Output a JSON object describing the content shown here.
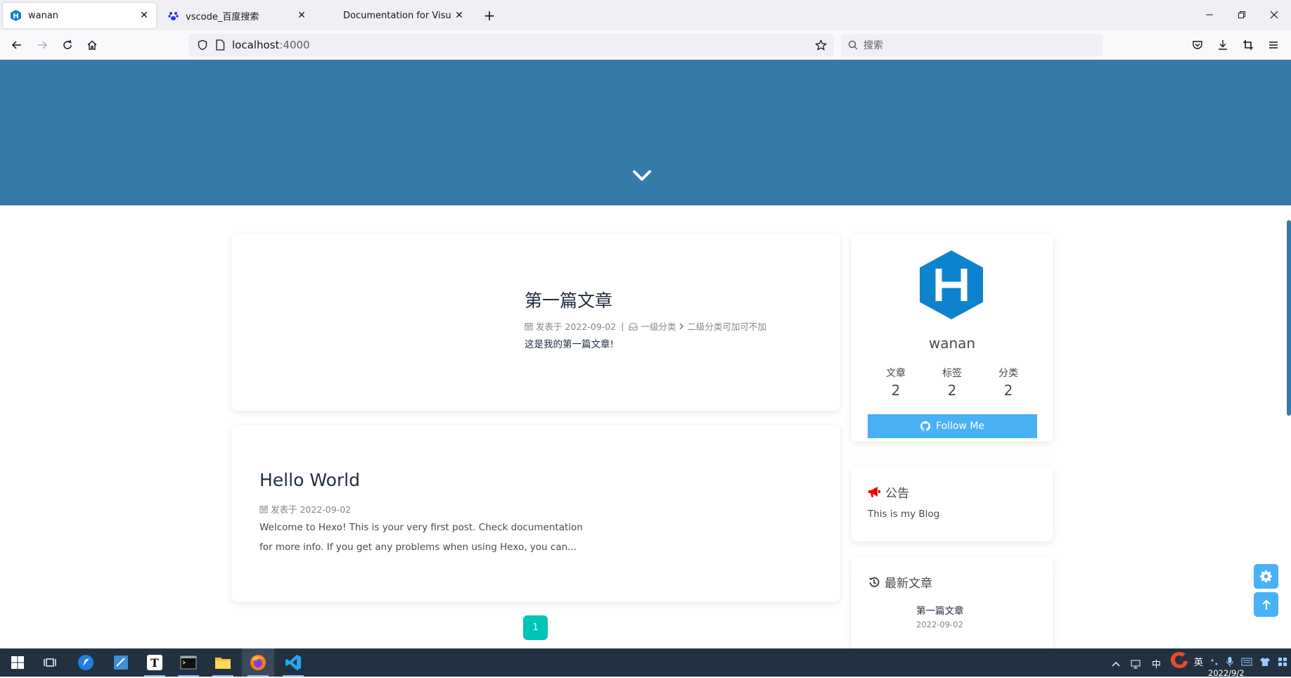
{
  "browser": {
    "tabs": [
      {
        "title": "wanan",
        "active": true
      },
      {
        "title": "vscode_百度搜索",
        "active": false
      },
      {
        "title": "Documentation for Visual Studio Code",
        "active": false
      }
    ],
    "url_host": "localhost",
    "url_port": ":4000",
    "search_placeholder": "搜索"
  },
  "posts": [
    {
      "title": "第一篇文章",
      "meta_published": "发表于 2022-09-02",
      "meta_sep": "|",
      "category_1": "一级分类",
      "category_2": "二级分类可加可不加",
      "excerpt": "这是我的第一篇文章!"
    },
    {
      "title": "Hello World",
      "meta_published": "发表于 2022-09-02",
      "excerpt_line1": "Welcome to Hexo! This is your very first post. Check documentation",
      "excerpt_line2": "for more info. If you get any problems when using Hexo, you can..."
    }
  ],
  "pagination": {
    "current": "1"
  },
  "sidebar": {
    "author_name": "wanan",
    "stats": [
      {
        "label": "文章",
        "value": "2"
      },
      {
        "label": "标签",
        "value": "2"
      },
      {
        "label": "分类",
        "value": "2"
      }
    ],
    "follow_label": "Follow Me",
    "announcement_title": "公告",
    "announcement_text": "This is my Blog",
    "recent_title": "最新文章",
    "recent_posts": [
      {
        "title": "第一篇文章",
        "date": "2022-09-02"
      }
    ]
  },
  "taskbar": {
    "tray_ime_en": "英",
    "tray_ime_cn": "中",
    "date": "2022/9/2"
  },
  "colors": {
    "hero": "#357ba9",
    "accent": "#49b1f5",
    "pager": "#00c4b6"
  }
}
